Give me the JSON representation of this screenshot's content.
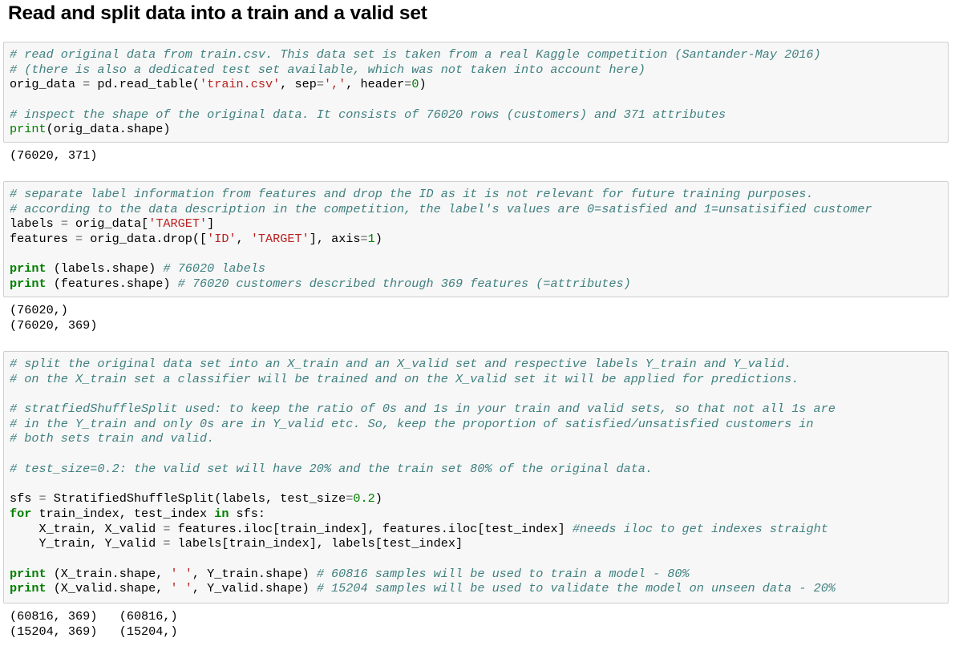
{
  "heading": "Read and split data into a train and a valid set",
  "cells": [
    {
      "input": [
        [
          [
            "c",
            "# read original data from train.csv. This data set is taken from a real Kaggle competition (Santander-May 2016)"
          ]
        ],
        [
          [
            "c",
            "# (there is also a dedicated test set available, which was not taken into account here)"
          ]
        ],
        [
          [
            "",
            "orig_data "
          ],
          [
            "o",
            "="
          ],
          [
            "",
            " pd.read_table("
          ],
          [
            "s",
            "'train.csv'"
          ],
          [
            "",
            ", sep"
          ],
          [
            "o",
            "="
          ],
          [
            "s",
            "','"
          ],
          [
            "",
            ", header"
          ],
          [
            "o",
            "="
          ],
          [
            "n",
            "0"
          ],
          [
            "",
            ")"
          ]
        ],
        [],
        [
          [
            "c",
            "# inspect the shape of the original data. It consists of 76020 rows (customers) and 371 attributes"
          ]
        ],
        [
          [
            "b",
            "print"
          ],
          [
            "",
            "(orig_data.shape)"
          ]
        ]
      ],
      "output": [
        "(76020, 371)"
      ]
    },
    {
      "input": [
        [
          [
            "c",
            "# separate label information from features and drop the ID as it is not relevant for future training purposes."
          ]
        ],
        [
          [
            "c",
            "# according to the data description in the competition, the label's values are 0=satisfied and 1=unsatisified customer"
          ]
        ],
        [
          [
            "",
            "labels "
          ],
          [
            "o",
            "="
          ],
          [
            "",
            " orig_data["
          ],
          [
            "s",
            "'TARGET'"
          ],
          [
            "",
            "]"
          ]
        ],
        [
          [
            "",
            "features "
          ],
          [
            "o",
            "="
          ],
          [
            "",
            " orig_data.drop(["
          ],
          [
            "s",
            "'ID'"
          ],
          [
            "",
            ", "
          ],
          [
            "s",
            "'TARGET'"
          ],
          [
            "",
            "], axis"
          ],
          [
            "o",
            "="
          ],
          [
            "n",
            "1"
          ],
          [
            "",
            ")"
          ]
        ],
        [],
        [
          [
            "k",
            "print"
          ],
          [
            "",
            " (labels.shape) "
          ],
          [
            "c",
            "# 76020 labels"
          ]
        ],
        [
          [
            "k",
            "print"
          ],
          [
            "",
            " (features.shape) "
          ],
          [
            "c",
            "# 76020 customers described through 369 features (=attributes)"
          ]
        ]
      ],
      "output": [
        "(76020,)",
        "(76020, 369)"
      ]
    },
    {
      "input": [
        [
          [
            "c",
            "# split the original data set into an X_train and an X_valid set and respective labels Y_train and Y_valid."
          ]
        ],
        [
          [
            "c",
            "# on the X_train set a classifier will be trained and on the X_valid set it will be applied for predictions."
          ]
        ],
        [],
        [
          [
            "c",
            "# stratfiedShuffleSplit used: to keep the ratio of 0s and 1s in your train and valid sets, so that not all 1s are"
          ]
        ],
        [
          [
            "c",
            "# in the Y_train and only 0s are in Y_valid etc. So, keep the proportion of satisfied/unsatisfied customers in"
          ]
        ],
        [
          [
            "c",
            "# both sets train and valid."
          ]
        ],
        [],
        [
          [
            "c",
            "# test_size=0.2: the valid set will have 20% and the train set 80% of the original data."
          ]
        ],
        [],
        [
          [
            "",
            "sfs "
          ],
          [
            "o",
            "="
          ],
          [
            "",
            " StratifiedShuffleSplit(labels, test_size"
          ],
          [
            "o",
            "="
          ],
          [
            "n",
            "0.2"
          ],
          [
            "",
            ")"
          ]
        ],
        [
          [
            "k",
            "for"
          ],
          [
            "",
            " train_index, test_index "
          ],
          [
            "k",
            "in"
          ],
          [
            "",
            " sfs:"
          ]
        ],
        [
          [
            "",
            "    X_train, X_valid "
          ],
          [
            "o",
            "="
          ],
          [
            "",
            " features.iloc[train_index], features.iloc[test_index] "
          ],
          [
            "c",
            "#needs iloc to get indexes straight"
          ]
        ],
        [
          [
            "",
            "    Y_train, Y_valid "
          ],
          [
            "o",
            "="
          ],
          [
            "",
            " labels[train_index], labels[test_index]"
          ]
        ],
        [],
        [
          [
            "k",
            "print"
          ],
          [
            "",
            " (X_train.shape, "
          ],
          [
            "s",
            "' '"
          ],
          [
            "",
            ", Y_train.shape) "
          ],
          [
            "c",
            "# 60816 samples will be used to train a model - 80%"
          ]
        ],
        [
          [
            "k",
            "print"
          ],
          [
            "",
            " (X_valid.shape, "
          ],
          [
            "s",
            "' '"
          ],
          [
            "",
            ", Y_valid.shape) "
          ],
          [
            "c",
            "# 15204 samples will be used to validate the model on unseen data - 20%"
          ]
        ]
      ],
      "output": [
        "(60816, 369)   (60816,)",
        "(15204, 369)   (15204,)"
      ]
    }
  ]
}
